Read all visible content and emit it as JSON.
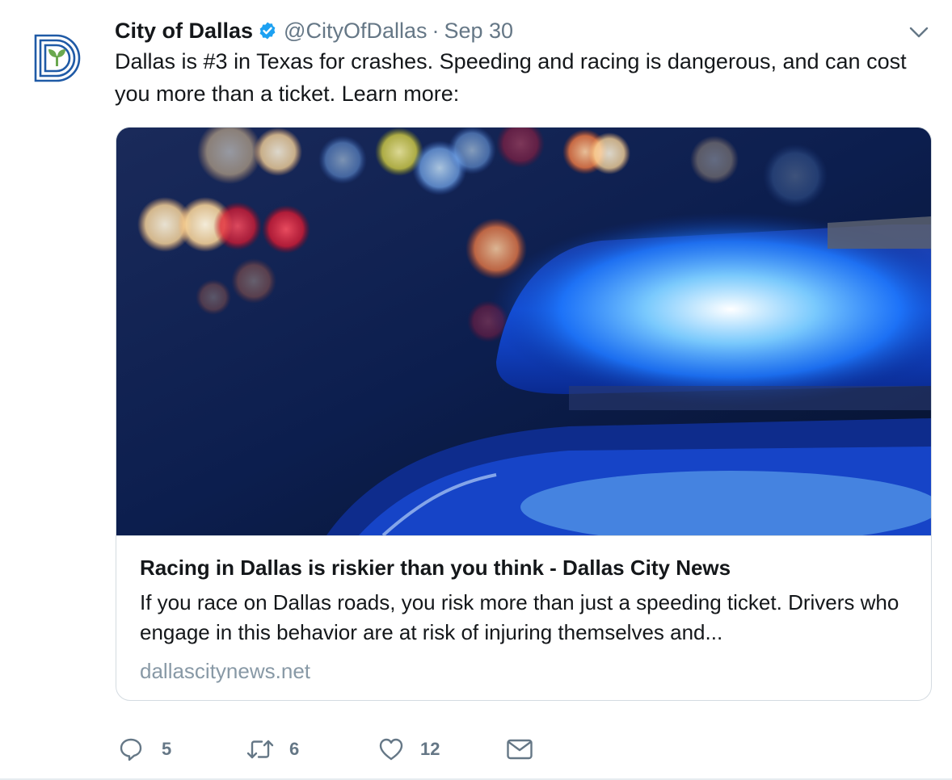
{
  "tweet": {
    "author": {
      "display_name": "City of Dallas",
      "handle": "@CityOfDallas",
      "avatar_icon": "city-of-dallas-logo-icon",
      "verified": true
    },
    "separator": "·",
    "date": "Sep 30",
    "text": "Dallas is #3 in Texas for crashes. Speeding and racing is dangerous, and can cost you more than a ticket. Learn more:",
    "card": {
      "image_icon": "police-light-photo",
      "title": "Racing in Dallas is riskier than you think - Dallas City News",
      "description": "If you race on Dallas roads, you risk more than just a speeding ticket. Drivers who engage in this behavior are at risk of injuring themselves and...",
      "domain": "dallascitynews.net"
    },
    "actions": {
      "reply_count": "5",
      "retweet_count": "6",
      "like_count": "12"
    }
  },
  "colors": {
    "text": "#14171a",
    "secondary": "#657786",
    "verified": "#1da1f2",
    "border": "#d4dbe1",
    "logo_blue": "#1f5aa6",
    "logo_green": "#6aa84f"
  }
}
